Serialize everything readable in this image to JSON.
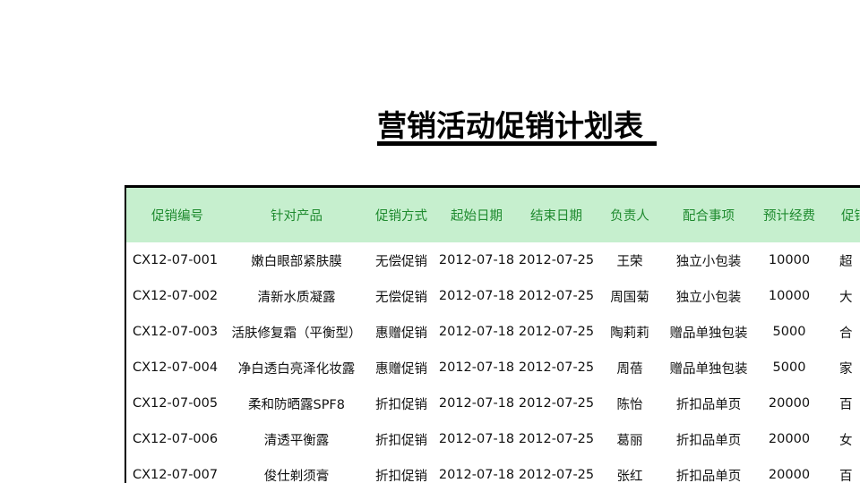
{
  "title": "营销活动促销计划表",
  "table": {
    "headers": [
      "促销编号",
      "针对产品",
      "促销方式",
      "起始日期",
      "结束日期",
      "负责人",
      "配合事项",
      "预计经费",
      "促销"
    ],
    "rows": [
      [
        "CX12-07-001",
        "嫩白眼部紧肤膜",
        "无偿促销",
        "2012-07-18",
        "2012-07-25",
        "王荣",
        "独立小包装",
        "10000",
        "超"
      ],
      [
        "CX12-07-002",
        "清新水质凝露",
        "无偿促销",
        "2012-07-18",
        "2012-07-25",
        "周国菊",
        "独立小包装",
        "10000",
        "大"
      ],
      [
        "CX12-07-003",
        "活肤修复霜（平衡型）",
        "惠赠促销",
        "2012-07-18",
        "2012-07-25",
        "陶莉莉",
        "赠品单独包装",
        "5000",
        "合"
      ],
      [
        "CX12-07-004",
        "净白透白亮泽化妆露",
        "惠赠促销",
        "2012-07-18",
        "2012-07-25",
        "周蓓",
        "赠品单独包装",
        "5000",
        "家"
      ],
      [
        "CX12-07-005",
        "柔和防晒露SPF8",
        "折扣促销",
        "2012-07-18",
        "2012-07-25",
        "陈怡",
        "折扣品单页",
        "20000",
        "百"
      ],
      [
        "CX12-07-006",
        "清透平衡露",
        "折扣促销",
        "2012-07-18",
        "2012-07-25",
        "葛丽",
        "折扣品单页",
        "20000",
        "女"
      ],
      [
        "CX12-07-007",
        "俊仕剃须膏",
        "折扣促销",
        "2012-07-18",
        "2012-07-25",
        "张红",
        "折扣品单页",
        "20000",
        "百"
      ]
    ]
  }
}
